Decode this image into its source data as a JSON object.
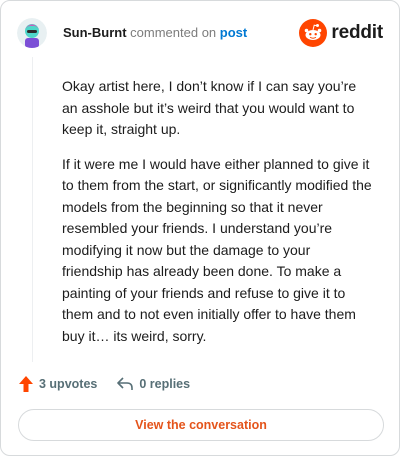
{
  "header": {
    "username": "Sun-Burnt",
    "commented_text": "commented on",
    "post_link": "post",
    "brand_word": "reddit"
  },
  "comment": {
    "paragraphs": [
      "Okay artist here, I don’t know if I can say you’re an asshole but it’s weird that you would want to keep it, straight up.",
      "If it were me I would have either planned to give it to them from the start, or significantly modified the models from the beginning so that it never resembled your friends. I understand you’re modifying it now but the damage to your friendship has already been done. To make a painting of your friends and refuse to give it to them and to not even initially offer to have them buy it… its weird, sorry."
    ]
  },
  "actions": {
    "upvotes": "3 upvotes",
    "replies": "0 replies"
  },
  "footer": {
    "view_conversation": "View the conversation"
  },
  "colors": {
    "brand_orange": "#ff4500",
    "link_blue": "#0079d3",
    "cta_text": "#e4541b"
  },
  "icons": [
    "avatar",
    "reddit-logo-icon",
    "upvote-arrow-icon",
    "reply-icon"
  ]
}
